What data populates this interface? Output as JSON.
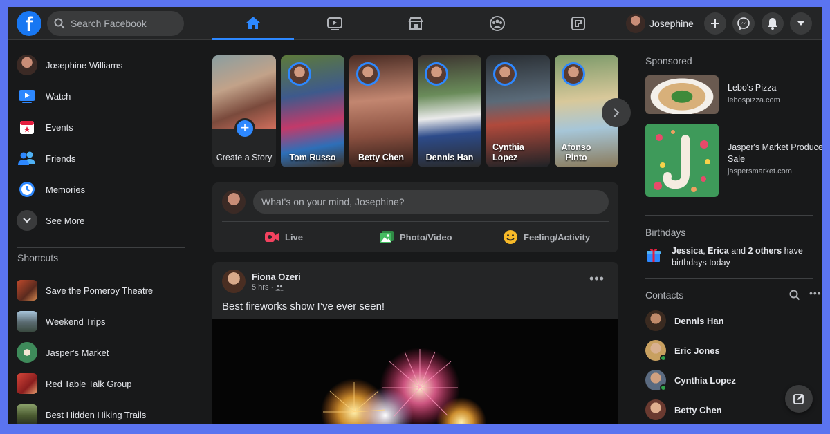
{
  "colors": {
    "accent": "#2d88ff",
    "background": "#18191a",
    "surface": "#242526",
    "frame": "#5b74f0"
  },
  "topbar": {
    "logo_icon": "facebook-logo",
    "search_placeholder": "Search Facebook",
    "nav": [
      {
        "name": "home",
        "icon": "home-icon",
        "active": true
      },
      {
        "name": "watch",
        "icon": "video-icon",
        "active": false
      },
      {
        "name": "marketplace",
        "icon": "store-icon",
        "active": false
      },
      {
        "name": "groups",
        "icon": "groups-icon",
        "active": false
      },
      {
        "name": "gaming",
        "icon": "gaming-icon",
        "active": false
      }
    ],
    "profile_name": "Josephine",
    "actions": [
      "plus-icon",
      "messenger-icon",
      "bell-icon",
      "caret-down-icon"
    ]
  },
  "left": {
    "items": [
      {
        "label": "Josephine Williams",
        "icon": "avatar"
      },
      {
        "label": "Watch",
        "icon": "watch-icon"
      },
      {
        "label": "Events",
        "icon": "calendar-icon"
      },
      {
        "label": "Friends",
        "icon": "friends-icon"
      },
      {
        "label": "Memories",
        "icon": "clock-icon"
      },
      {
        "label": "See More",
        "icon": "chevron-down-icon"
      }
    ],
    "shortcuts_title": "Shortcuts",
    "shortcuts": [
      {
        "label": "Save the Pomeroy Theatre"
      },
      {
        "label": "Weekend Trips"
      },
      {
        "label": "Jasper's Market"
      },
      {
        "label": "Red Table Talk Group"
      },
      {
        "label": "Best Hidden Hiking Trails"
      }
    ]
  },
  "stories": {
    "create_label": "Create a Story",
    "items": [
      {
        "name": "Tom Russo"
      },
      {
        "name": "Betty Chen"
      },
      {
        "name": "Dennis Han"
      },
      {
        "name": "Cynthia Lopez"
      },
      {
        "name": "Afonso Pinto"
      }
    ]
  },
  "composer": {
    "placeholder": "What's on your mind, Josephine?",
    "buttons": [
      {
        "label": "Live",
        "icon": "live-video-icon",
        "color": "#f3425f"
      },
      {
        "label": "Photo/Video",
        "icon": "photo-icon",
        "color": "#45bd62"
      },
      {
        "label": "Feeling/Activity",
        "icon": "smiley-icon",
        "color": "#f7b928"
      }
    ]
  },
  "post": {
    "author": "Fiona Ozeri",
    "time": "5 hrs",
    "audience_icon": "friends-audience-icon",
    "text": "Best fireworks show I’ve ever seen!"
  },
  "right": {
    "sponsored_title": "Sponsored",
    "ads": [
      {
        "title": "Lebo's Pizza",
        "url": "lebospizza.com"
      },
      {
        "title": "Jasper's Market Produce Sale",
        "url": "jaspersmarket.com"
      }
    ],
    "birthdays_title": "Birthdays",
    "birthday_names_1": "Jessica",
    "birthday_names_2": "Erica",
    "birthday_and": " and ",
    "birthday_others": "2 others",
    "birthday_suffix": " have birthdays today",
    "contacts_title": "Contacts",
    "contacts": [
      {
        "name": "Dennis Han",
        "online": false
      },
      {
        "name": "Eric Jones",
        "online": true
      },
      {
        "name": "Cynthia Lopez",
        "online": true
      },
      {
        "name": "Betty Chen",
        "online": false
      }
    ]
  }
}
